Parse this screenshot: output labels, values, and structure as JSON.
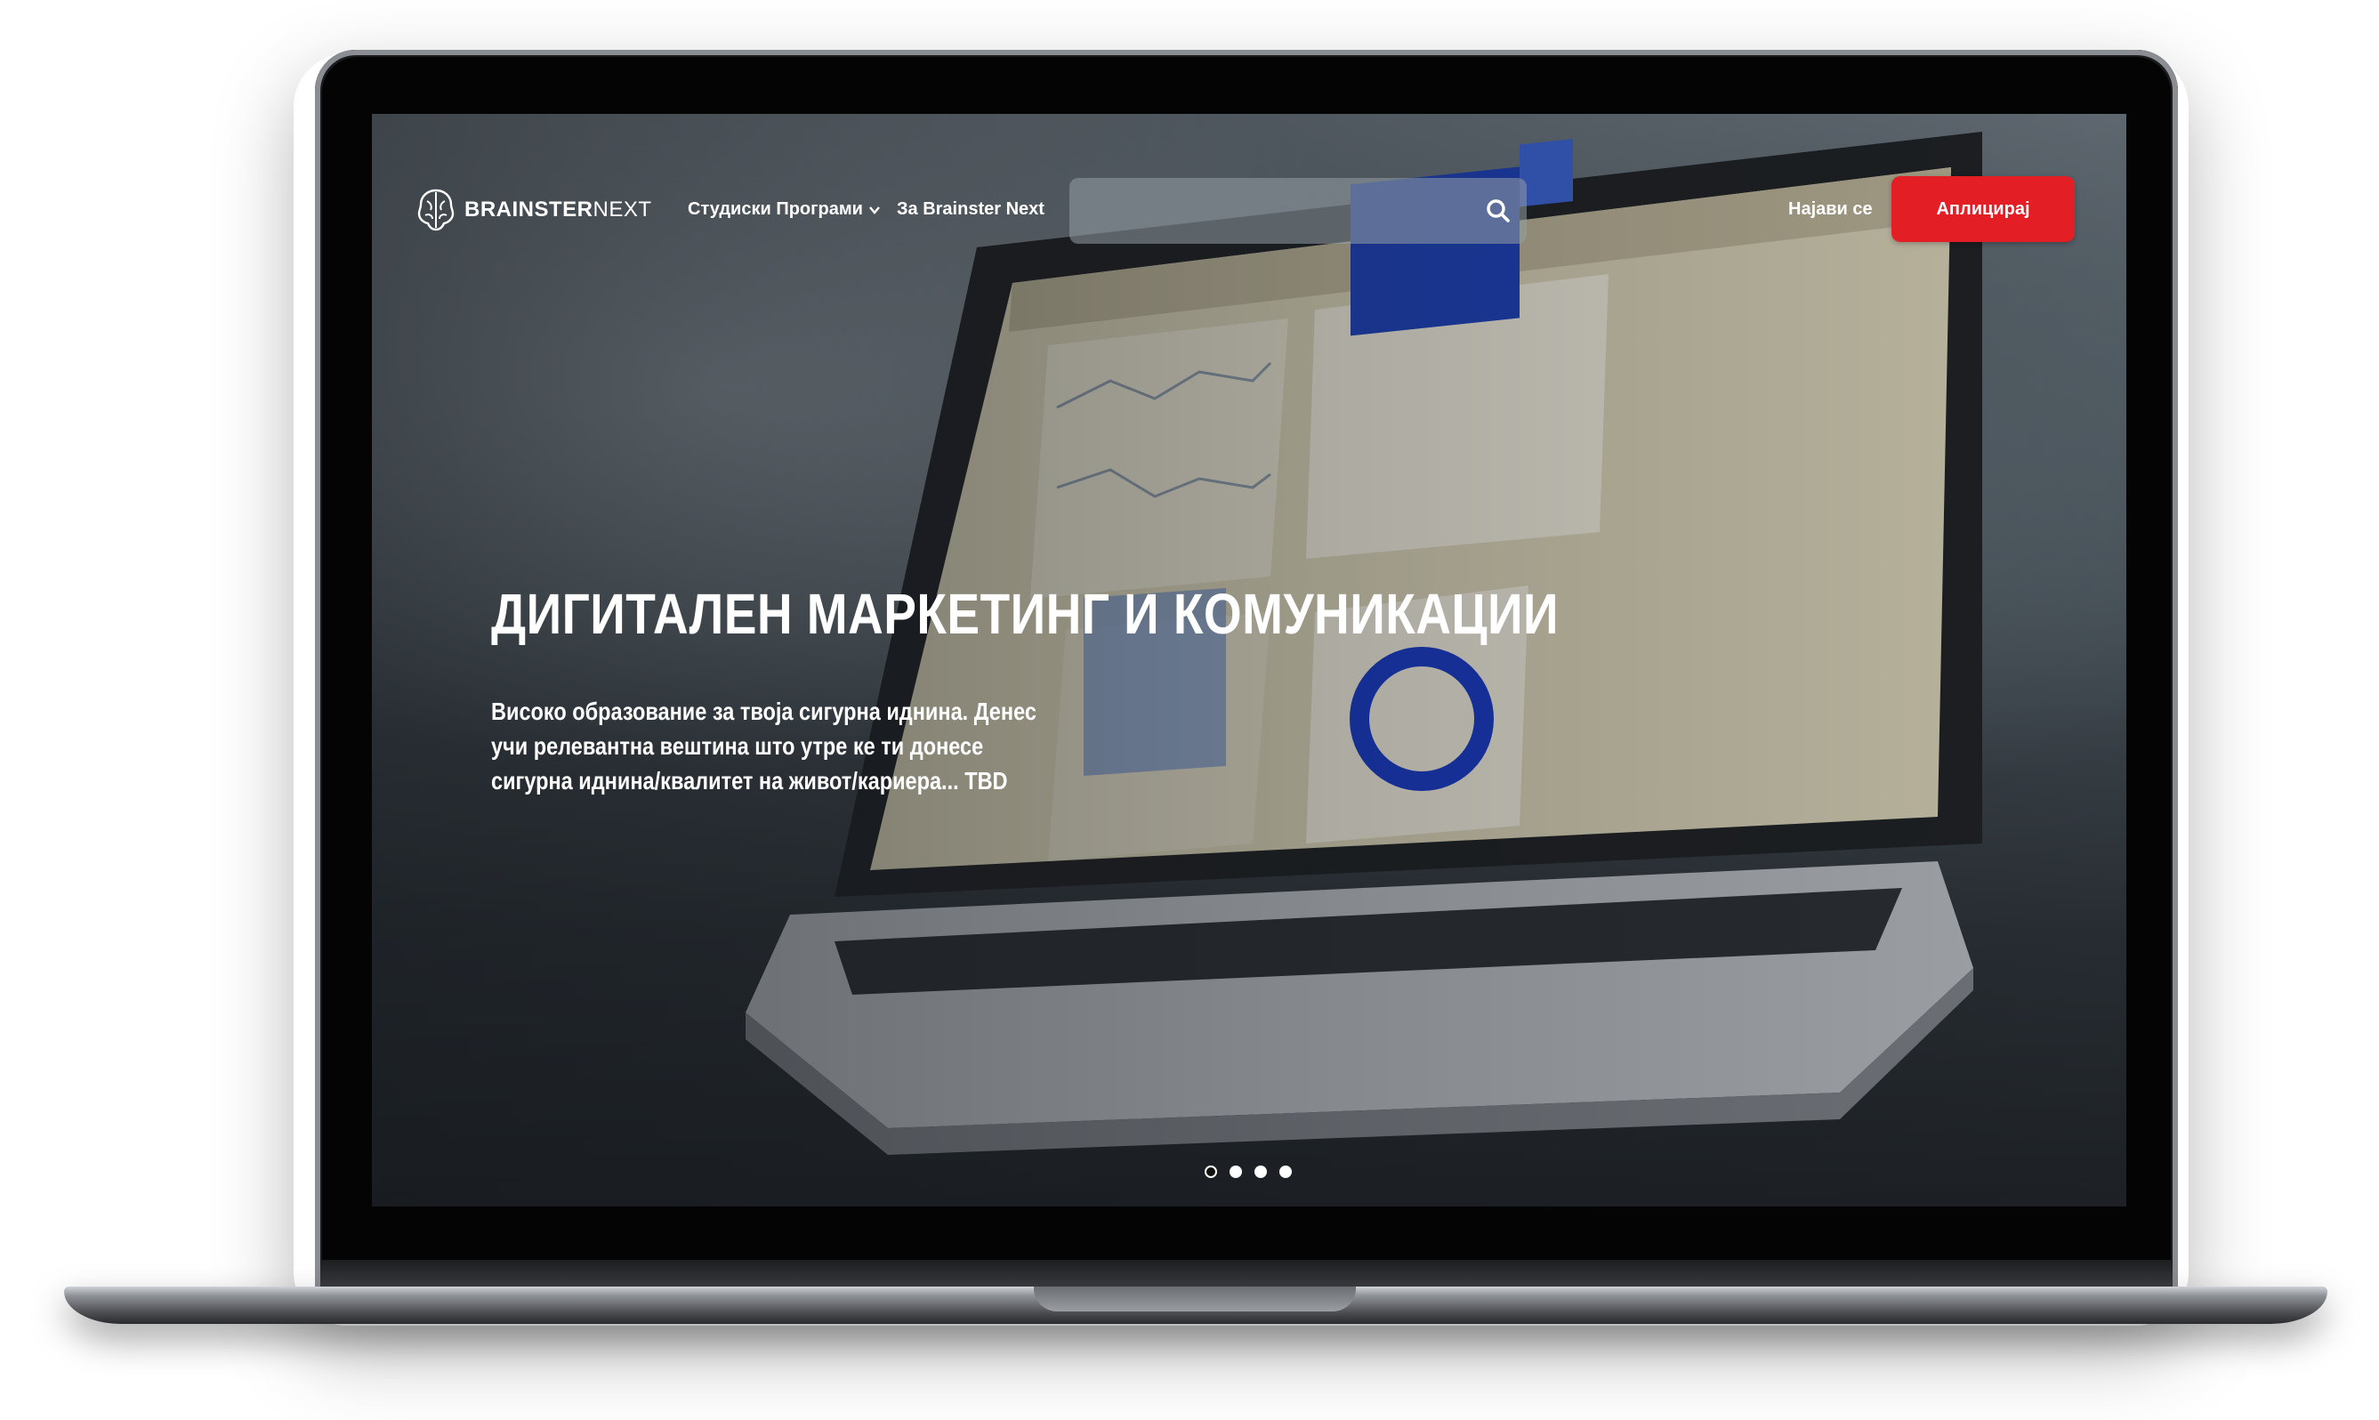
{
  "navbar": {
    "logo": {
      "brand_bold": "BRAINSTER",
      "brand_light": "NEXT"
    },
    "programs_label": "Студиски Програми",
    "about_label": "За Brainster Next",
    "search": {
      "value": "",
      "placeholder": ""
    },
    "login_label": "Најави се",
    "apply_label": "Аплицирај"
  },
  "hero": {
    "title": "ДИГИТАЛЕН МАРКЕТИНГ И КОМУНИКАЦИИ",
    "subtitle": "Високо образование за твоја сигурна иднина. Денес учи релевантна вештина што утре ке ти донесе сигурна иднина/квалитет на живот/кариера... TBD"
  },
  "carousel": {
    "slide_count": 4,
    "active_index": 0
  },
  "colors": {
    "accent": "#e41e25",
    "text": "#ffffff"
  },
  "icons": {
    "logo": "brain-icon",
    "dropdown": "chevron-down-icon",
    "search": "search-icon"
  }
}
